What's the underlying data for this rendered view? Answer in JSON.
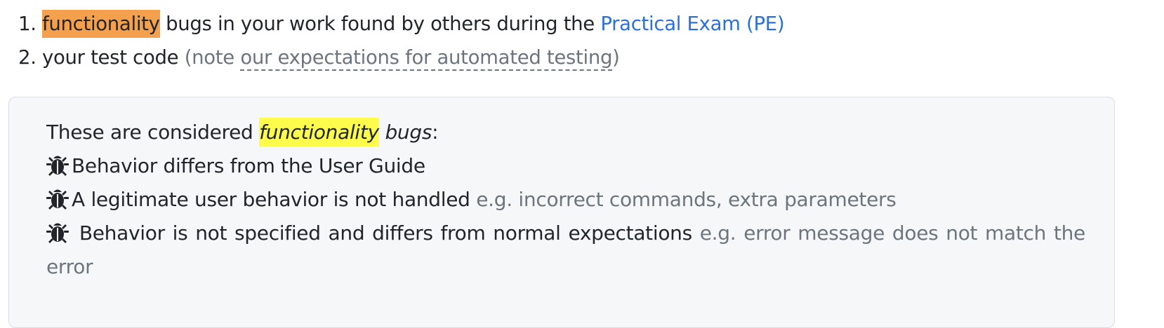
{
  "list": {
    "items": [
      {
        "number": "1.",
        "highlight": "functionality",
        "text": " bugs in your work found by others during the ",
        "link": "Practical Exam (PE)"
      },
      {
        "number": "2.",
        "text": "your test code ",
        "note_open": "(note ",
        "note_link": "our expectations for automated testing",
        "note_close": ")"
      }
    ]
  },
  "box": {
    "intro_prefix": "These are considered ",
    "intro_highlight": "functionality",
    "intro_suffix": " bugs",
    "intro_colon": ":",
    "bugs": [
      {
        "text": "Behavior differs from the User Guide",
        "example": ""
      },
      {
        "text": "A legitimate user behavior is not handled",
        "example": "e.g. incorrect commands, extra parameters"
      },
      {
        "text": "Behavior is not specified and differs from normal expectations",
        "example": "e.g. error message does not match the error"
      }
    ]
  },
  "colors": {
    "highlight_orange": "#f4a04c",
    "highlight_yellow": "#fdfc4c",
    "link_blue": "#2a6fdb",
    "muted_gray": "#6c757d"
  }
}
